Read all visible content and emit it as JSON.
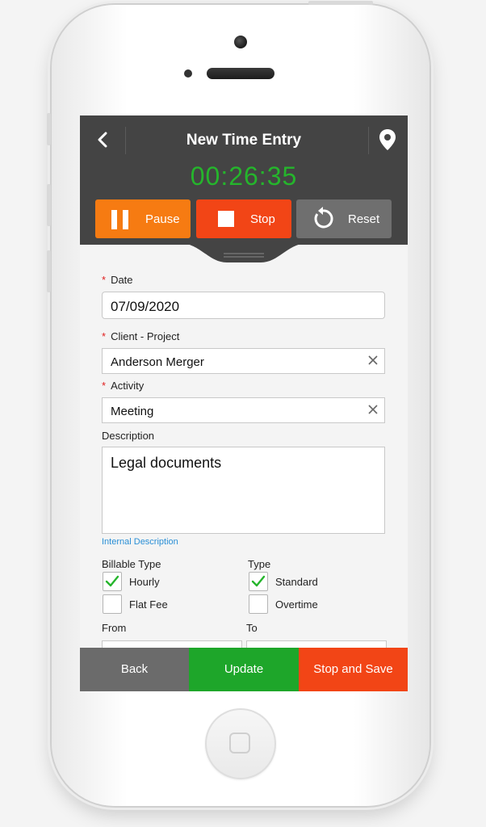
{
  "header": {
    "title": "New Time Entry",
    "timer": "00:26:35"
  },
  "controls": {
    "pause": "Pause",
    "stop": "Stop",
    "reset": "Reset"
  },
  "form": {
    "date_label": "Date",
    "date_value": "07/09/2020",
    "client_label": "Client - Project",
    "client_value": "Anderson Merger",
    "activity_label": "Activity",
    "activity_value": "Meeting",
    "description_label": "Description",
    "description_value": "Legal documents",
    "internal_link": "Internal Description",
    "billable_label": "Billable Type",
    "billable_options": [
      {
        "label": "Hourly",
        "checked": true
      },
      {
        "label": "Flat Fee",
        "checked": false
      }
    ],
    "type_label": "Type",
    "type_options": [
      {
        "label": "Standard",
        "checked": true
      },
      {
        "label": "Overtime",
        "checked": false
      }
    ],
    "from_label": "From",
    "to_label": "To"
  },
  "footer": {
    "back": "Back",
    "update": "Update",
    "stop_save": "Stop and Save"
  },
  "colors": {
    "timer": "#25b52c",
    "pause": "#f67b12",
    "stop": "#f24516",
    "reset": "#6f6f6f",
    "back": "#6b6b6b",
    "update": "#1ea62a",
    "stop_save": "#f24516",
    "link": "#2a8fd6"
  }
}
